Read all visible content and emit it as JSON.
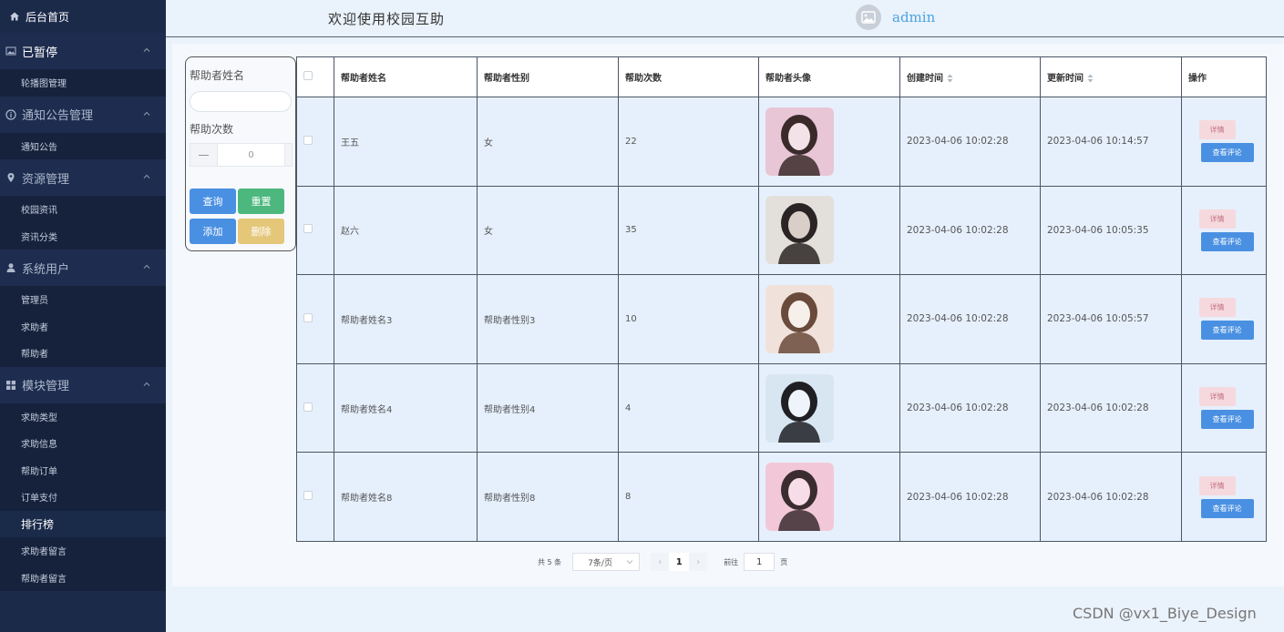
{
  "sidebar": {
    "home": "后台首页",
    "groups": [
      {
        "label": "已暂停",
        "items": [
          "轮播图管理"
        ]
      },
      {
        "label": "通知公告管理",
        "items": [
          "通知公告"
        ]
      },
      {
        "label": "资源管理",
        "items": [
          "校园资讯",
          "资讯分类"
        ]
      },
      {
        "label": "系统用户",
        "items": [
          "管理员",
          "求助者",
          "帮助者"
        ]
      },
      {
        "label": "模块管理",
        "items": [
          "求助类型",
          "求助信息",
          "帮助订单",
          "订单支付",
          "排行榜",
          "求助者留言",
          "帮助者留言"
        ]
      }
    ]
  },
  "header": {
    "welcome": "欢迎使用校园互助",
    "username": "admin"
  },
  "search": {
    "name_label": "帮助者姓名",
    "name_value": "",
    "count_label": "帮助次数",
    "count_value": "0",
    "minus": "—",
    "query": "查询",
    "reset": "重置",
    "add": "添加",
    "delete": "删除"
  },
  "table": {
    "headers": [
      "帮助者姓名",
      "帮助者性别",
      "帮助次数",
      "帮助者头像",
      "创建时间",
      "更新时间",
      "操作"
    ],
    "rows": [
      {
        "name": "王五",
        "gender": "女",
        "count": "22",
        "created": "2023-04-06 10:02:28",
        "updated": "2023-04-06 10:14:57"
      },
      {
        "name": "赵六",
        "gender": "女",
        "count": "35",
        "created": "2023-04-06 10:02:28",
        "updated": "2023-04-06 10:05:35"
      },
      {
        "name": "帮助者姓名3",
        "gender": "帮助者性别3",
        "count": "10",
        "created": "2023-04-06 10:02:28",
        "updated": "2023-04-06 10:05:57"
      },
      {
        "name": "帮助者姓名4",
        "gender": "帮助者性别4",
        "count": "4",
        "created": "2023-04-06 10:02:28",
        "updated": "2023-04-06 10:02:28"
      },
      {
        "name": "帮助者姓名8",
        "gender": "帮助者性别8",
        "count": "8",
        "created": "2023-04-06 10:02:28",
        "updated": "2023-04-06 10:02:28"
      }
    ],
    "detail_label": "详情",
    "comment_label": "查看评论"
  },
  "pager": {
    "total": "共 5 条",
    "page_size": "7条/页",
    "prev": "‹",
    "current": "1",
    "next": "›",
    "goto_label": "前往",
    "goto_value": "1",
    "page_unit": "页"
  },
  "watermark": "CSDN @vx1_Biye_Design",
  "colors": {
    "sidebar_bg": "#1c2a4a",
    "primary": "#4a90e2",
    "success": "#4cb87e",
    "warning": "#e5c77a",
    "detail": "#f6d9de"
  }
}
